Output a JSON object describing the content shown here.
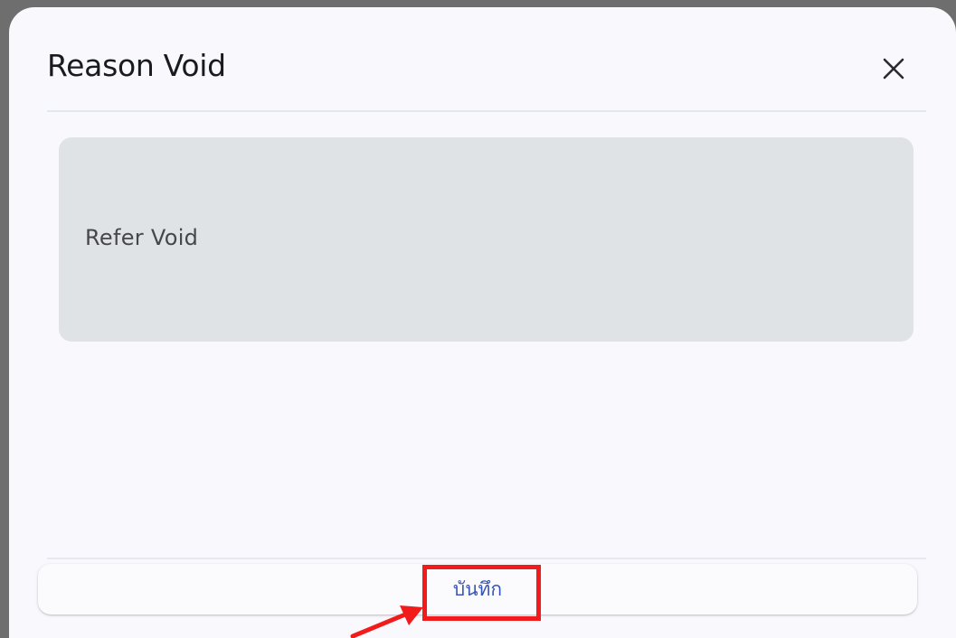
{
  "dialog": {
    "title": "Reason Void",
    "close_icon": "close-icon",
    "reason_text": "Refer Void",
    "save_label": "บันทึก"
  },
  "annotation": {
    "highlight_color": "#f21b1b",
    "arrow_icon": "arrow-pointer-icon"
  },
  "colors": {
    "dialog_background": "#f8f8fd",
    "card_background": "#e0e3e6",
    "save_text": "#3a56b5",
    "backdrop": "#6e6e6e"
  }
}
